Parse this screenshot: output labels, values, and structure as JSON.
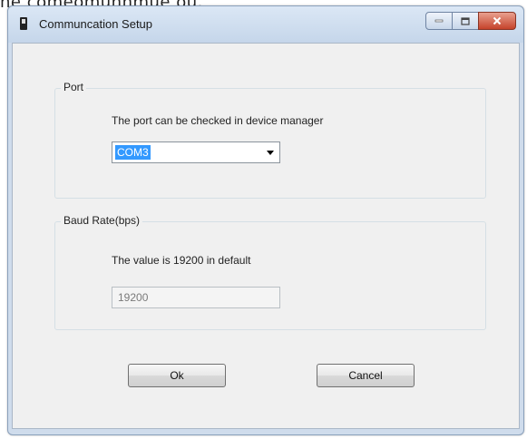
{
  "above_text": "ne comeomunnmue ou.",
  "window": {
    "title": "Communcation Setup",
    "icons": {
      "app": "device-icon",
      "minimize": "minimize-icon",
      "maximize": "maximize-icon",
      "close": "close-icon"
    }
  },
  "port_group": {
    "label": "Port",
    "hint": "The port can be checked in device manager",
    "selected_value": "COM3"
  },
  "baud_group": {
    "label": "Baud Rate(bps)",
    "hint": "The value is 19200 in default",
    "value": "19200"
  },
  "buttons": {
    "ok": "Ok",
    "cancel": "Cancel"
  },
  "colors": {
    "selection": "#3399ff",
    "close_button": "#c5432b"
  }
}
